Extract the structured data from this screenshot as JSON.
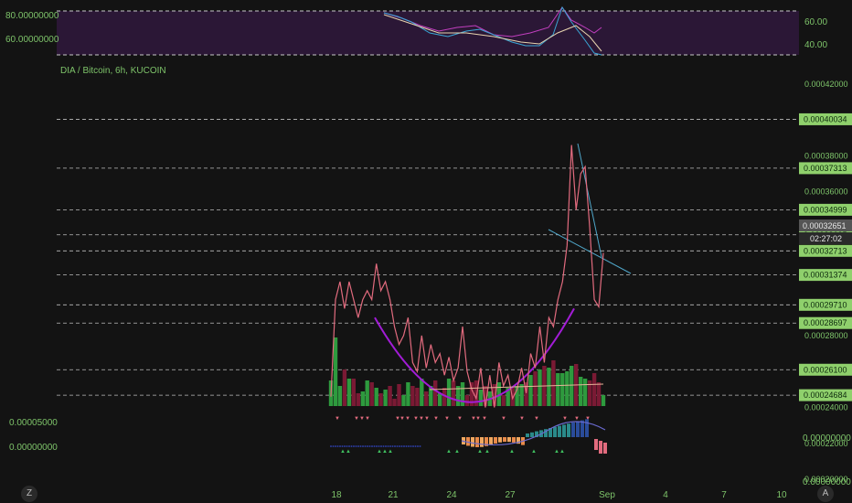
{
  "title": "DIA / Bitcoin, 6h, KUCOIN",
  "rsi": {
    "left_labels": [
      "80.00000000",
      "60.00000000"
    ],
    "right_labels": [
      "60.00",
      "40.00"
    ],
    "fill": "#2b1736",
    "line_color": "#c23fbf",
    "signal_color": "#3aa7d6"
  },
  "price_axis": {
    "plain_ticks": [
      "0.00042000",
      "0.00038000",
      "0.00036000",
      "0.00028000",
      "0.00024000",
      "0.00022000",
      "0.00020000"
    ],
    "boxed_ticks": [
      "0.00040034",
      "0.00037313",
      "0.00034999",
      "0.00033605",
      "0.00032713",
      "0.00031374",
      "0.00029710",
      "0.00028697",
      "0.00026100",
      "0.00024684"
    ],
    "current": "0.00032651",
    "countdown": "02:27:02"
  },
  "osc": {
    "left_labels": [
      "0.00005000",
      "0.00000000"
    ],
    "right_labels": [
      "0.00000000",
      "0.00000000"
    ]
  },
  "x_axis": [
    "18",
    "21",
    "24",
    "27",
    "Sep",
    "4",
    "7",
    "10"
  ],
  "buttons": {
    "left": "Z",
    "right": "A"
  },
  "colors": {
    "price_line": "#e26b7e",
    "cup": "#a21cd6",
    "trend": "#4fa6c9",
    "vol_up": "#2e9a3e",
    "vol_down": "#7a1a34",
    "text": "#7ec46a",
    "box_bg": "#8fd06c"
  },
  "chart_data": {
    "type": "line",
    "series": [
      {
        "values": [
          0.000246,
          0.0003,
          0.00031,
          0.000295,
          0.00031,
          0.0003,
          0.00029,
          0.0003,
          0.000305,
          0.0003,
          0.00032,
          0.000305,
          0.00031,
          0.0003,
          0.000285,
          0.000275,
          0.00028,
          0.00029,
          0.000265,
          0.00026,
          0.00028,
          0.000262,
          0.000275,
          0.000265,
          0.00027,
          0.000258,
          0.000268,
          0.000255,
          0.000262,
          0.000285,
          0.00026,
          0.00025,
          0.000245,
          0.000262,
          0.00024,
          0.000258,
          0.00024,
          0.000265,
          0.000252,
          0.000258,
          0.000245,
          0.00025,
          0.000262,
          0.000248,
          0.00027,
          0.000262,
          0.000285,
          0.000265,
          0.00029,
          0.000285,
          0.0003,
          0.00031,
          0.00033,
          0.000386,
          0.00035,
          0.00037,
          0.000374,
          0.00034,
          0.0003,
          0.000296,
          0.000326
        ]
      }
    ],
    "volume": [
      28,
      75,
      22,
      40,
      30,
      30,
      14,
      16,
      28,
      26,
      20,
      14,
      18,
      22,
      8,
      24,
      12,
      26,
      22,
      20,
      30,
      16,
      22,
      28,
      14,
      20,
      30,
      28,
      22,
      26,
      12,
      26,
      28,
      18,
      22,
      16,
      24,
      26,
      12,
      20,
      20,
      22,
      24,
      26,
      34,
      38,
      40,
      44,
      42,
      50,
      36,
      36,
      38,
      44,
      46,
      32,
      30,
      28,
      36,
      26,
      12
    ],
    "cup": {
      "from": 0.00029,
      "bottom": 0.000243,
      "to": 0.000295
    },
    "ylim": [
      0.000196,
      0.000426
    ]
  }
}
